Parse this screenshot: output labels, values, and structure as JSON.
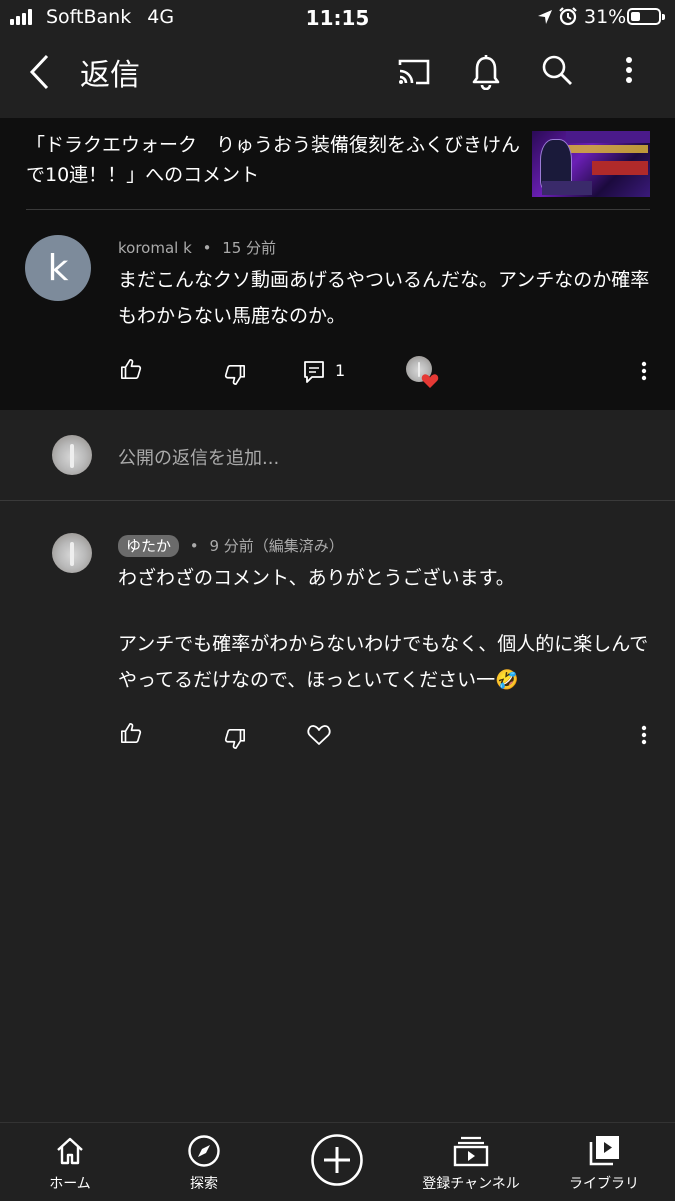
{
  "status_bar": {
    "carrier": "SoftBank",
    "network": "4G",
    "time": "11:15",
    "battery": "31%",
    "battery_level": 0.31
  },
  "header": {
    "title": "返信",
    "back_icon": "chevron-left-icon",
    "cast_icon": "cast-icon",
    "bell_icon": "bell-icon",
    "search_icon": "search-icon",
    "more_icon": "more-vert-icon"
  },
  "video": {
    "title": "「ドラクエウォーク　りゅうおう装備復刻をふくびきけんで10連！！」へのコメント",
    "thumbnail_icon": "video-thumbnail"
  },
  "main_comment": {
    "avatar_letter": "k",
    "author": "koromal k",
    "separator": "•",
    "time": "15 分前",
    "text": "まだこんなクソ動画あげるやついるんだな。アンチなのか確率もわからない馬鹿なのか。",
    "reply_count": "1"
  },
  "reply_input": {
    "placeholder": "公開の返信を追加..."
  },
  "reply": {
    "author": "ゆたか",
    "separator": "•",
    "time": "9 分前（編集済み）",
    "text_line1": "わざわざのコメント、ありがとうございます。",
    "text_line2": "アンチでも確率がわからないわけでもなく、個人的に楽しんでやってるだけなので、ほっといてください一🤣"
  },
  "bottom_nav": {
    "items": [
      {
        "label": "ホーム",
        "icon": "home-icon"
      },
      {
        "label": "探索",
        "icon": "compass-icon"
      },
      {
        "label": "",
        "icon": "add-icon"
      },
      {
        "label": "登録チャンネル",
        "icon": "subscriptions-icon"
      },
      {
        "label": "ライブラリ",
        "icon": "library-icon"
      }
    ]
  },
  "colors": {
    "background": "#212121",
    "card": "#0f0f0f",
    "secondary_text": "#aaaaaa",
    "heart": "#e53935",
    "avatar_k": "#7d8b9b"
  }
}
